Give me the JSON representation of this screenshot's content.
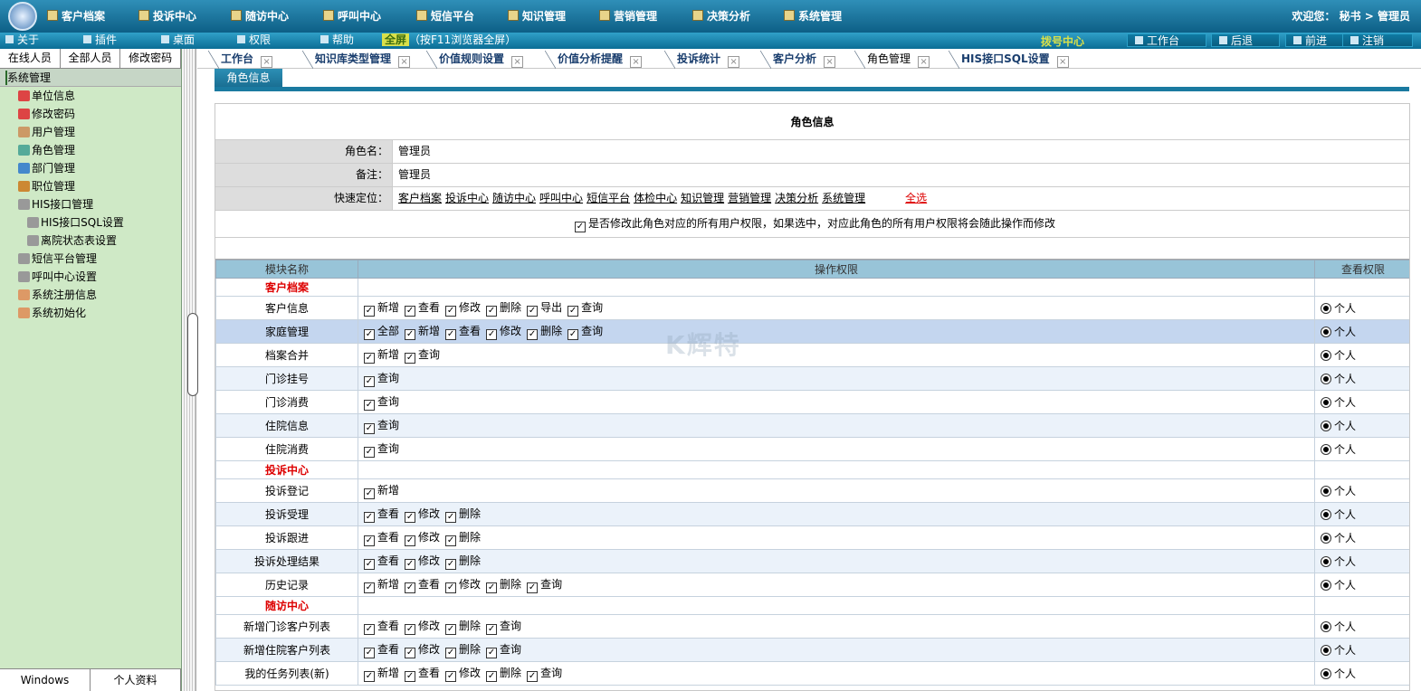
{
  "top_nav": [
    "客户档案",
    "投诉中心",
    "随访中心",
    "呼叫中心",
    "短信平台",
    "知识管理",
    "营销管理",
    "决策分析",
    "系统管理"
  ],
  "welcome": "欢迎您：  秘书 > 管理员",
  "toolbar_left": [
    "关于",
    "插件",
    "桌面",
    "权限",
    "帮助"
  ],
  "fullscreen": {
    "label": "全屏",
    "hint": "（按F11浏览器全屏）"
  },
  "dial_center": "拨号中心",
  "toolbar_right": [
    "工作台",
    "后退",
    "前进",
    "注销"
  ],
  "sidebar": {
    "tabs": [
      "在线人员",
      "全部人员",
      "修改密码"
    ],
    "root": "系统管理",
    "items": [
      {
        "label": "单位信息",
        "level": 1,
        "icon": "card-icon"
      },
      {
        "label": "修改密码",
        "level": 1,
        "icon": "card-icon"
      },
      {
        "label": "用户管理",
        "level": 1,
        "icon": "users-icon"
      },
      {
        "label": "角色管理",
        "level": 1,
        "icon": "role-icon"
      },
      {
        "label": "部门管理",
        "level": 1,
        "icon": "dept-icon"
      },
      {
        "label": "职位管理",
        "level": 1,
        "icon": "position-icon"
      },
      {
        "label": "HIS接口管理",
        "level": 1,
        "icon": "gear-icon"
      },
      {
        "label": "HIS接口SQL设置",
        "level": 2,
        "icon": "gear-icon"
      },
      {
        "label": "离院状态表设置",
        "level": 2,
        "icon": "gear-icon"
      },
      {
        "label": "短信平台管理",
        "level": 1,
        "icon": "gear-icon"
      },
      {
        "label": "呼叫中心设置",
        "level": 1,
        "icon": "gear-icon"
      },
      {
        "label": "系统注册信息",
        "level": 1,
        "icon": "home-icon"
      },
      {
        "label": "系统初始化",
        "level": 1,
        "icon": "home-icon"
      }
    ],
    "bottom": [
      "Windows",
      "个人资料"
    ]
  },
  "tabs": [
    {
      "label": "工作台",
      "active": false
    },
    {
      "label": "知识库类型管理",
      "active": false
    },
    {
      "label": "价值规则设置",
      "active": false
    },
    {
      "label": "价值分析提醒",
      "active": false
    },
    {
      "label": "投诉统计",
      "active": false
    },
    {
      "label": "客户分析",
      "active": false
    },
    {
      "label": "角色管理",
      "active": true
    },
    {
      "label": "HIS接口SQL设置",
      "active": false
    }
  ],
  "subtab": "角色信息",
  "form": {
    "title": "角色信息",
    "role_name_label": "角色名：",
    "role_name": "管理员",
    "remark_label": "备注：",
    "remark": "管理员",
    "quick_label": "快速定位：",
    "quick_links": [
      "客户档案",
      "投诉中心",
      "随访中心",
      "呼叫中心",
      "短信平台",
      "体检中心",
      "知识管理",
      "营销管理",
      "决策分析",
      "系统管理"
    ],
    "select_all": "全选",
    "notice": "是否修改此角色对应的所有用户权限，如果选中，对应此角色的所有用户权限将会随此操作而修改"
  },
  "perm_headers": [
    "模块名称",
    "操作权限",
    "查看权限"
  ],
  "perm_rows": [
    {
      "section": "客户档案"
    },
    {
      "module": "客户信息",
      "ops": [
        "新增",
        "查看",
        "修改",
        "删除",
        "导出",
        "查询"
      ],
      "view": "个人"
    },
    {
      "module": "家庭管理",
      "ops": [
        "全部",
        "新增",
        "查看",
        "修改",
        "删除",
        "查询"
      ],
      "view": "个人"
    },
    {
      "module": "档案合并",
      "ops": [
        "新增",
        "查询"
      ],
      "view": "个人"
    },
    {
      "module": "门诊挂号",
      "ops": [
        "查询"
      ],
      "view": "个人"
    },
    {
      "module": "门诊消费",
      "ops": [
        "查询"
      ],
      "view": "个人"
    },
    {
      "module": "住院信息",
      "ops": [
        "查询"
      ],
      "view": "个人"
    },
    {
      "module": "住院消费",
      "ops": [
        "查询"
      ],
      "view": "个人"
    },
    {
      "section": "投诉中心"
    },
    {
      "module": "投诉登记",
      "ops": [
        "新增"
      ],
      "view": "个人"
    },
    {
      "module": "投诉受理",
      "ops": [
        "查看",
        "修改",
        "删除"
      ],
      "view": "个人"
    },
    {
      "module": "投诉跟进",
      "ops": [
        "查看",
        "修改",
        "删除"
      ],
      "view": "个人"
    },
    {
      "module": "投诉处理结果",
      "ops": [
        "查看",
        "修改",
        "删除"
      ],
      "view": "个人"
    },
    {
      "module": "历史记录",
      "ops": [
        "新增",
        "查看",
        "修改",
        "删除",
        "查询"
      ],
      "view": "个人"
    },
    {
      "section": "随访中心"
    },
    {
      "module": "新增门诊客户列表",
      "ops": [
        "查看",
        "修改",
        "删除",
        "查询"
      ],
      "view": "个人"
    },
    {
      "module": "新增住院客户列表",
      "ops": [
        "查看",
        "修改",
        "删除",
        "查询"
      ],
      "view": "个人"
    },
    {
      "module": "我的任务列表(新)",
      "ops": [
        "新增",
        "查看",
        "修改",
        "删除",
        "查询"
      ],
      "view": "个人"
    }
  ],
  "watermark": "K辉特"
}
